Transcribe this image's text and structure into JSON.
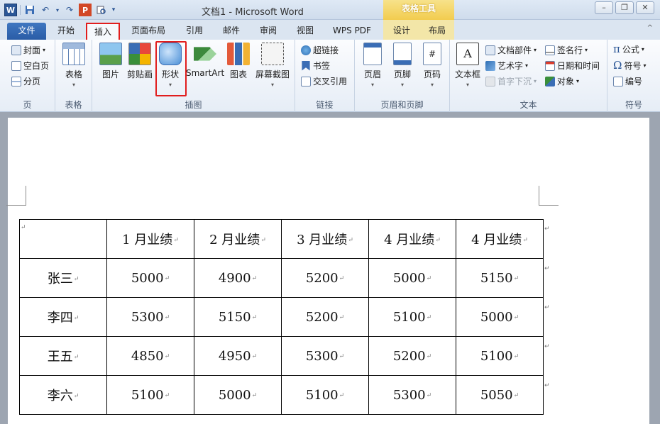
{
  "window": {
    "title": "文档1 - Microsoft Word",
    "context_tool": "表格工具"
  },
  "tabs": [
    "文件",
    "开始",
    "插入",
    "页面布局",
    "引用",
    "邮件",
    "审阅",
    "视图",
    "WPS PDF",
    "设计",
    "布局"
  ],
  "ribbon": {
    "pages": {
      "label": "页",
      "items": [
        "封面",
        "空白页",
        "分页"
      ]
    },
    "tables": {
      "label": "表格",
      "table": "表格"
    },
    "illustrations": {
      "label": "插图",
      "picture": "图片",
      "clipart": "剪贴画",
      "shapes": "形状",
      "smartart": "SmartArt",
      "chart": "图表",
      "screenshot": "屏幕截图"
    },
    "links": {
      "label": "链接",
      "items": [
        "超链接",
        "书签",
        "交叉引用"
      ]
    },
    "header_footer": {
      "label": "页眉和页脚",
      "header": "页眉",
      "footer": "页脚",
      "pagenum": "页码"
    },
    "text": {
      "label": "文本",
      "textbox": "文本框",
      "items": [
        "文档部件",
        "艺术字",
        "首字下沉"
      ],
      "items2": [
        "签名行",
        "日期和时间",
        "对象"
      ]
    },
    "symbols": {
      "label": "符号",
      "items": [
        "公式",
        "符号",
        "编号"
      ]
    }
  },
  "table": {
    "header": [
      "",
      "1 月业绩",
      "2 月业绩",
      "3 月业绩",
      "4 月业绩",
      "4 月业绩"
    ],
    "rows": [
      [
        "张三",
        "5000",
        "4900",
        "5200",
        "5000",
        "5150"
      ],
      [
        "李四",
        "5300",
        "5150",
        "5200",
        "5100",
        "5000"
      ],
      [
        "王五",
        "4850",
        "4950",
        "5300",
        "5200",
        "5100"
      ],
      [
        "李六",
        "5100",
        "5000",
        "5100",
        "5300",
        "5050"
      ]
    ]
  },
  "glyphs": {
    "para": "↵",
    "dropdown": "▾",
    "collapse": "^"
  }
}
